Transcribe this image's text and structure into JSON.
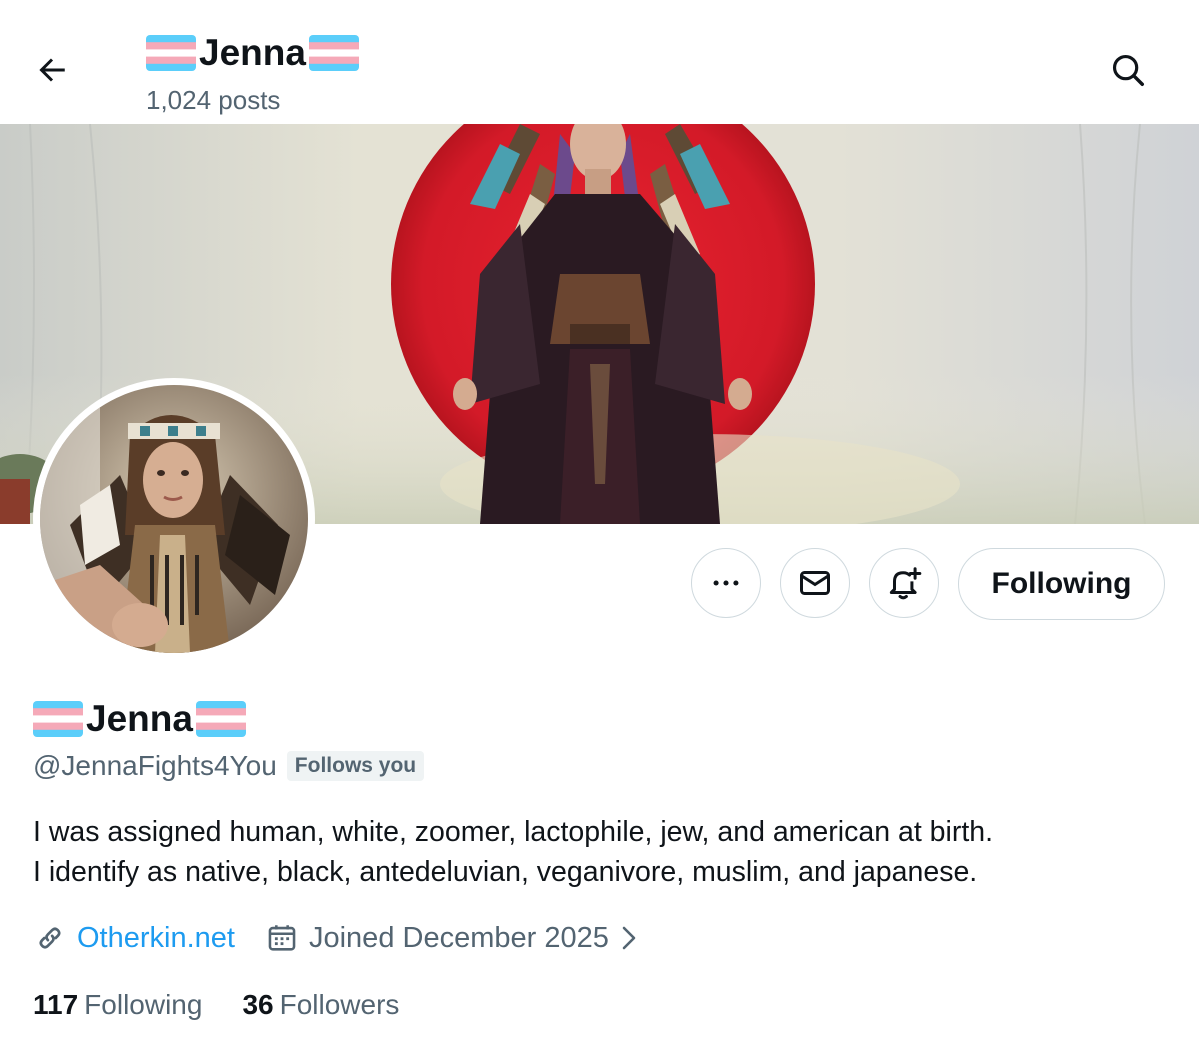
{
  "header": {
    "name": "Jenna",
    "posts": "1,024 posts"
  },
  "profile": {
    "display_name": "Jenna",
    "handle": "@JennaFights4You",
    "follows_you": "Follows you",
    "bio": [
      "I was assigned human, white, zoomer, lactophile, jew, and american at birth.",
      "I identify as native, black, antedeluvian, veganivore, muslim, and japanese."
    ],
    "website": "Otherkin.net",
    "joined": "Joined December 2025"
  },
  "actions": {
    "following_label": "Following"
  },
  "stats": {
    "following_count": "117",
    "following_label": "Following",
    "followers_count": "36",
    "followers_label": "Followers"
  },
  "icons": [
    "back-arrow-icon",
    "search-icon",
    "more-icon",
    "mail-icon",
    "bell-plus-icon",
    "link-icon",
    "calendar-icon",
    "chevron-right-icon",
    "trans-flag-icon"
  ],
  "colors": {
    "link": "#1d9bf0",
    "secondary_text": "#536471",
    "trans_blue": "#5bcefa",
    "trans_pink": "#f5a9b8"
  }
}
